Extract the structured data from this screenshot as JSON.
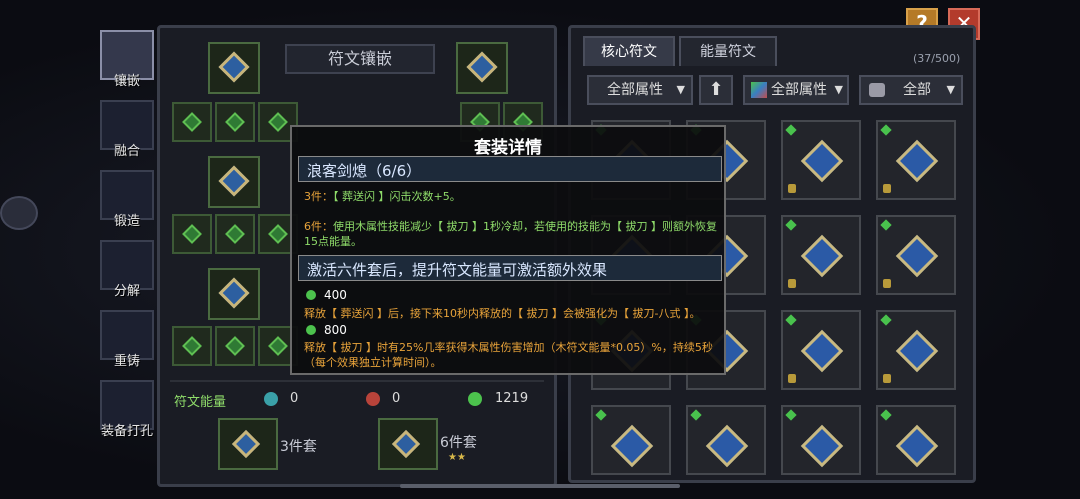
{
  "nav": {
    "items": [
      {
        "label": "镶嵌"
      },
      {
        "label": "融合"
      },
      {
        "label": "锻造"
      },
      {
        "label": "分解"
      },
      {
        "label": "重铸"
      },
      {
        "label": "装备打孔"
      }
    ]
  },
  "left_panel": {
    "title": "符文镶嵌",
    "energy_label": "符文能量",
    "energy_values": [
      "0",
      "0",
      "1219"
    ],
    "set_buttons": [
      {
        "label": "3件套"
      },
      {
        "label": "6件套",
        "stars": "★★"
      }
    ]
  },
  "right_panel": {
    "tabs": [
      "核心符文",
      "能量符文"
    ],
    "count": "(37/500)",
    "filters": {
      "attr1": "全部属性",
      "attr2": "全部属性",
      "type": "全部"
    }
  },
  "modal": {
    "title": "套装详情",
    "set_name": "浪客剑熄（6/6）",
    "line3_prefix": "3件：",
    "line3_text": "【 葬送闪 】闪击次数+5。",
    "line6_prefix": "6件：",
    "line6_text": "使用木属性技能减少【 拔刀 】1秒冷却，若使用的技能为【 拔刀 】则额外恢复15点能量。",
    "activate_header": "激活六件套后，提升符文能量可激活额外效果",
    "tiers": [
      {
        "value": "400",
        "text": "释放【 葬送闪 】后，接下来10秒内释放的【 拔刀 】会被强化为【 拔刀-八式 】。"
      },
      {
        "value": "800",
        "text": "释放【 拔刀 】时有25%几率获得木属性伤害增加（木符文能量*0.05）%，持续5秒（每个效果独立计算时间）。"
      }
    ]
  },
  "colors": {
    "green_text": "#8fdc6a",
    "orange_text": "#e8a33a",
    "accent_blue": "#1d2a3a"
  }
}
